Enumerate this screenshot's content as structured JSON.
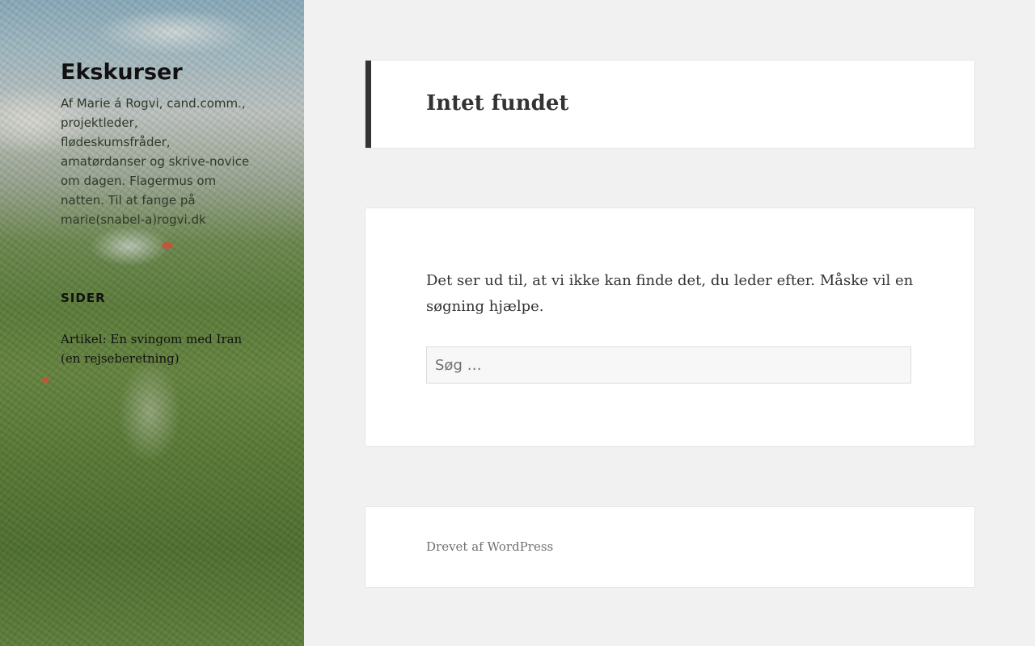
{
  "sidebar": {
    "site_title": "Ekskurser",
    "site_description": "Af Marie á Rogvi, cand.comm., projektleder, flødeskumsfråder, amatørdanser og skrive-novice om dagen. Flagermus om natten. Til at fange på marie(snabel-a)rogvi.dk",
    "widget_title": "SIDER",
    "pages": [
      {
        "label": "Artikel: En svingom med Iran (en rejseberetning)"
      }
    ]
  },
  "main": {
    "page_title": "Intet fundet",
    "message": "Det ser ud til, at vi ikke kan finde det, du leder efter. Måske vil en søgning hjælpe.",
    "search": {
      "placeholder": "Søg …",
      "value": ""
    }
  },
  "footer": {
    "credit": "Drevet af WordPress"
  }
}
